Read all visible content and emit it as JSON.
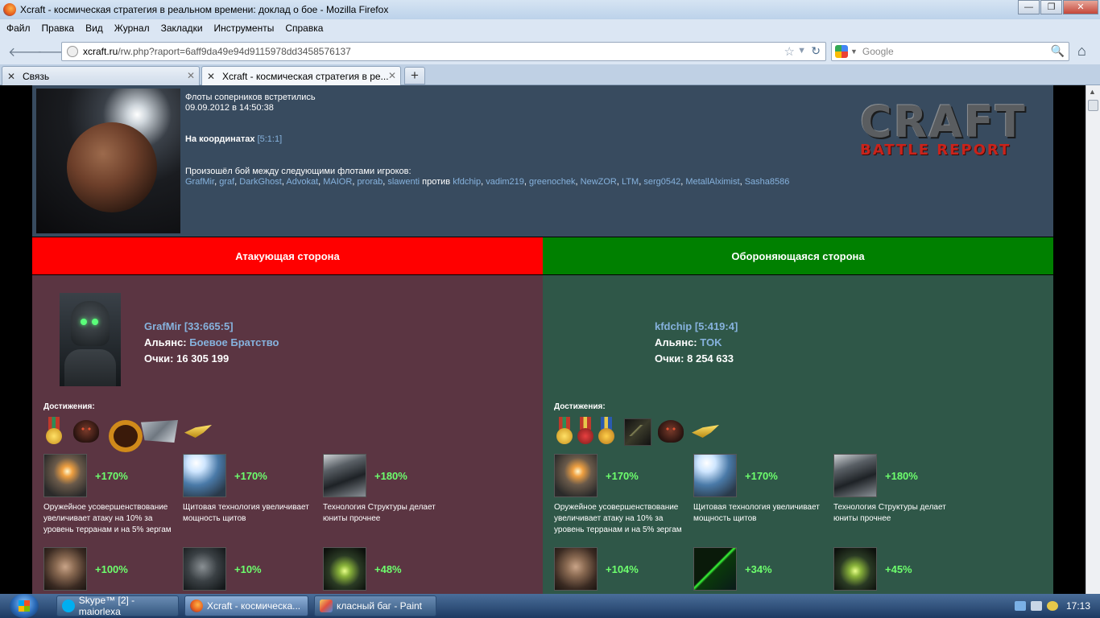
{
  "window": {
    "title": "Xcraft - космическая стратегия в реальном времени: доклад о бое - Mozilla Firefox"
  },
  "menu": [
    "Файл",
    "Правка",
    "Вид",
    "Журнал",
    "Закладки",
    "Инструменты",
    "Справка"
  ],
  "urlbar": {
    "domain": "xcraft.ru",
    "path": "/rw.php?raport=6aff9da49e94d9115978dd3458576137"
  },
  "search": {
    "placeholder": "Google"
  },
  "tabs": [
    {
      "label": "Связь"
    },
    {
      "label": "Xcraft - космическая стратегия в ре..."
    }
  ],
  "report": {
    "line1": "Флоты соперников встретились",
    "line2": "09.09.2012 в 14:50:38",
    "coords_label": "На координатах",
    "coords": "[5:1:1]",
    "battle_intro": "Произошёл бой между следующими флотами игроков:",
    "attackers": [
      "GrafMir",
      "graf",
      "DarkGhost",
      "Advokat",
      "MAIOR",
      "prorab",
      "slawenti"
    ],
    "versus": "против",
    "defenders": [
      "kfdchip",
      "vadim219",
      "greenochek",
      "NewZOR",
      "LTM",
      "serg0542",
      "MetallAlximist",
      "Sasha8586"
    ],
    "logo_big": "CRAFT",
    "logo_sub": "BATTLE REPORT"
  },
  "attack": {
    "header": "Атакующая сторона",
    "player": "GrafMir [33:665:5]",
    "alliance_label": "Альянс:",
    "alliance": "Боевое Братство",
    "points_label": "Очки:",
    "points": "16 305 199",
    "achievements_label": "Достижения:",
    "techs": [
      {
        "pct": "+170%",
        "desc": "Оружейное усовершенствование увеличивает атаку на 10% за уровень терранам и на 5% зергам"
      },
      {
        "pct": "+170%",
        "desc": "Щитовая технология увеличивает мощность щитов"
      },
      {
        "pct": "+180%",
        "desc": "Технология Структуры делает юниты прочнее"
      },
      {
        "pct": "+100%",
        "desc": ""
      },
      {
        "pct": "+10%",
        "desc": ""
      },
      {
        "pct": "+48%",
        "desc": ""
      }
    ]
  },
  "defense": {
    "header": "Обороняющаяся сторона",
    "player": "kfdchip [5:419:4]",
    "alliance_label": "Альянс:",
    "alliance": "TOK",
    "points_label": "Очки:",
    "points": "8 254 633",
    "achievements_label": "Достижения:",
    "techs": [
      {
        "pct": "+170%",
        "desc": "Оружейное усовершенствование увеличивает атаку на 10% за уровень терранам и на 5% зергам"
      },
      {
        "pct": "+170%",
        "desc": "Щитовая технология увеличивает мощность щитов"
      },
      {
        "pct": "+180%",
        "desc": "Технология Структуры делает юниты прочнее"
      },
      {
        "pct": "+104%",
        "desc": ""
      },
      {
        "pct": "+34%",
        "desc": ""
      },
      {
        "pct": "+45%",
        "desc": ""
      }
    ]
  },
  "taskbar": {
    "items": [
      "Skype™ [2] - maiorlexa",
      "Xcraft - космическа...",
      "класный баг - Paint"
    ],
    "clock": "17:13"
  }
}
